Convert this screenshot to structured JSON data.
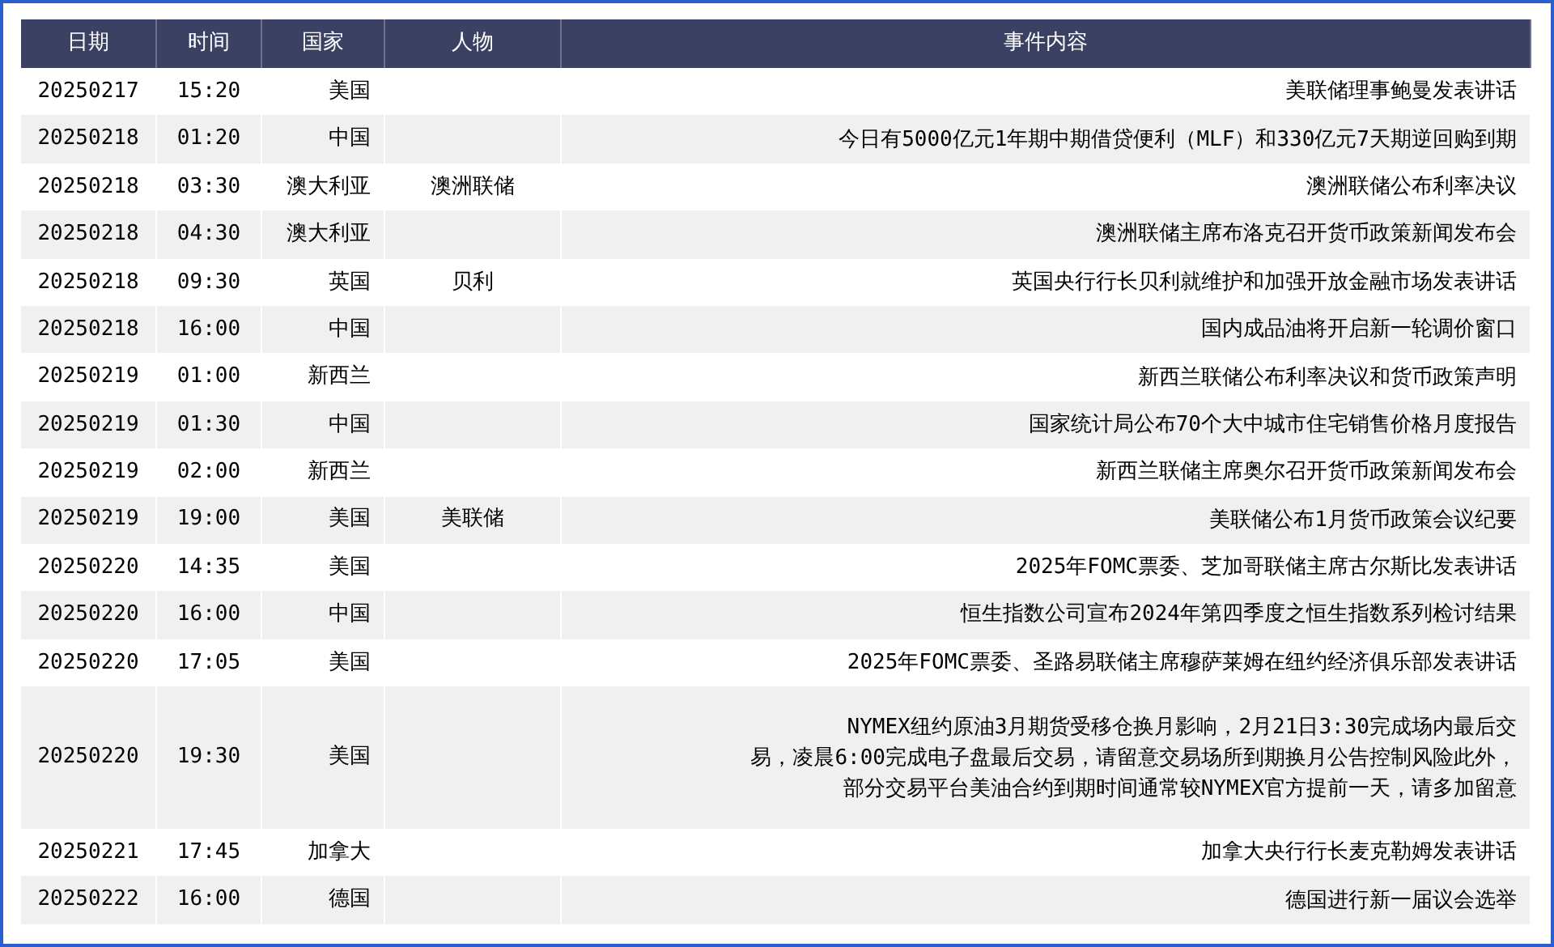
{
  "table": {
    "columns": [
      "日期",
      "时间",
      "国家",
      "人物",
      "事件内容"
    ],
    "rows": [
      {
        "date": "20250217",
        "time": "15:20",
        "country": "美国",
        "person": "",
        "event": [
          "美联储理事鲍曼发表讲话"
        ]
      },
      {
        "date": "20250218",
        "time": "01:20",
        "country": "中国",
        "person": "",
        "event": [
          "今日有5000亿元1年期中期借贷便利（MLF）和330亿元7天期逆回购到期"
        ]
      },
      {
        "date": "20250218",
        "time": "03:30",
        "country": "澳大利亚",
        "person": "澳洲联储",
        "event": [
          "澳洲联储公布利率决议"
        ]
      },
      {
        "date": "20250218",
        "time": "04:30",
        "country": "澳大利亚",
        "person": "",
        "event": [
          "澳洲联储主席布洛克召开货币政策新闻发布会"
        ]
      },
      {
        "date": "20250218",
        "time": "09:30",
        "country": "英国",
        "person": "贝利",
        "event": [
          "英国央行行长贝利就维护和加强开放金融市场发表讲话"
        ]
      },
      {
        "date": "20250218",
        "time": "16:00",
        "country": "中国",
        "person": "",
        "event": [
          "国内成品油将开启新一轮调价窗口"
        ]
      },
      {
        "date": "20250219",
        "time": "01:00",
        "country": "新西兰",
        "person": "",
        "event": [
          "新西兰联储公布利率决议和货币政策声明"
        ]
      },
      {
        "date": "20250219",
        "time": "01:30",
        "country": "中国",
        "person": "",
        "event": [
          "国家统计局公布70个大中城市住宅销售价格月度报告"
        ]
      },
      {
        "date": "20250219",
        "time": "02:00",
        "country": "新西兰",
        "person": "",
        "event": [
          "新西兰联储主席奥尔召开货币政策新闻发布会"
        ]
      },
      {
        "date": "20250219",
        "time": "19:00",
        "country": "美国",
        "person": "美联储",
        "event": [
          "美联储公布1月货币政策会议纪要"
        ]
      },
      {
        "date": "20250220",
        "time": "14:35",
        "country": "美国",
        "person": "",
        "event": [
          "2025年FOMC票委、芝加哥联储主席古尔斯比发表讲话"
        ]
      },
      {
        "date": "20250220",
        "time": "16:00",
        "country": "中国",
        "person": "",
        "event": [
          "恒生指数公司宣布2024年第四季度之恒生指数系列检讨结果"
        ]
      },
      {
        "date": "20250220",
        "time": "17:05",
        "country": "美国",
        "person": "",
        "event": [
          "2025年FOMC票委、圣路易联储主席穆萨莱姆在纽约经济俱乐部发表讲话"
        ]
      },
      {
        "date": "20250220",
        "time": "19:30",
        "country": "美国",
        "person": "",
        "event": [
          "NYMEX纽约原油3月期货受移仓换月影响，2月21日3:30完成场内最后交",
          "易，凌晨6:00完成电子盘最后交易，请留意交易场所到期换月公告控制风险此外，",
          "部分交易平台美油合约到期时间通常较NYMEX官方提前一天，请多加留意"
        ]
      },
      {
        "date": "20250221",
        "time": "17:45",
        "country": "加拿大",
        "person": "",
        "event": [
          "加拿大央行行长麦克勒姆发表讲话"
        ]
      },
      {
        "date": "20250222",
        "time": "16:00",
        "country": "德国",
        "person": "",
        "event": [
          "德国进行新一届议会选举"
        ]
      }
    ]
  }
}
